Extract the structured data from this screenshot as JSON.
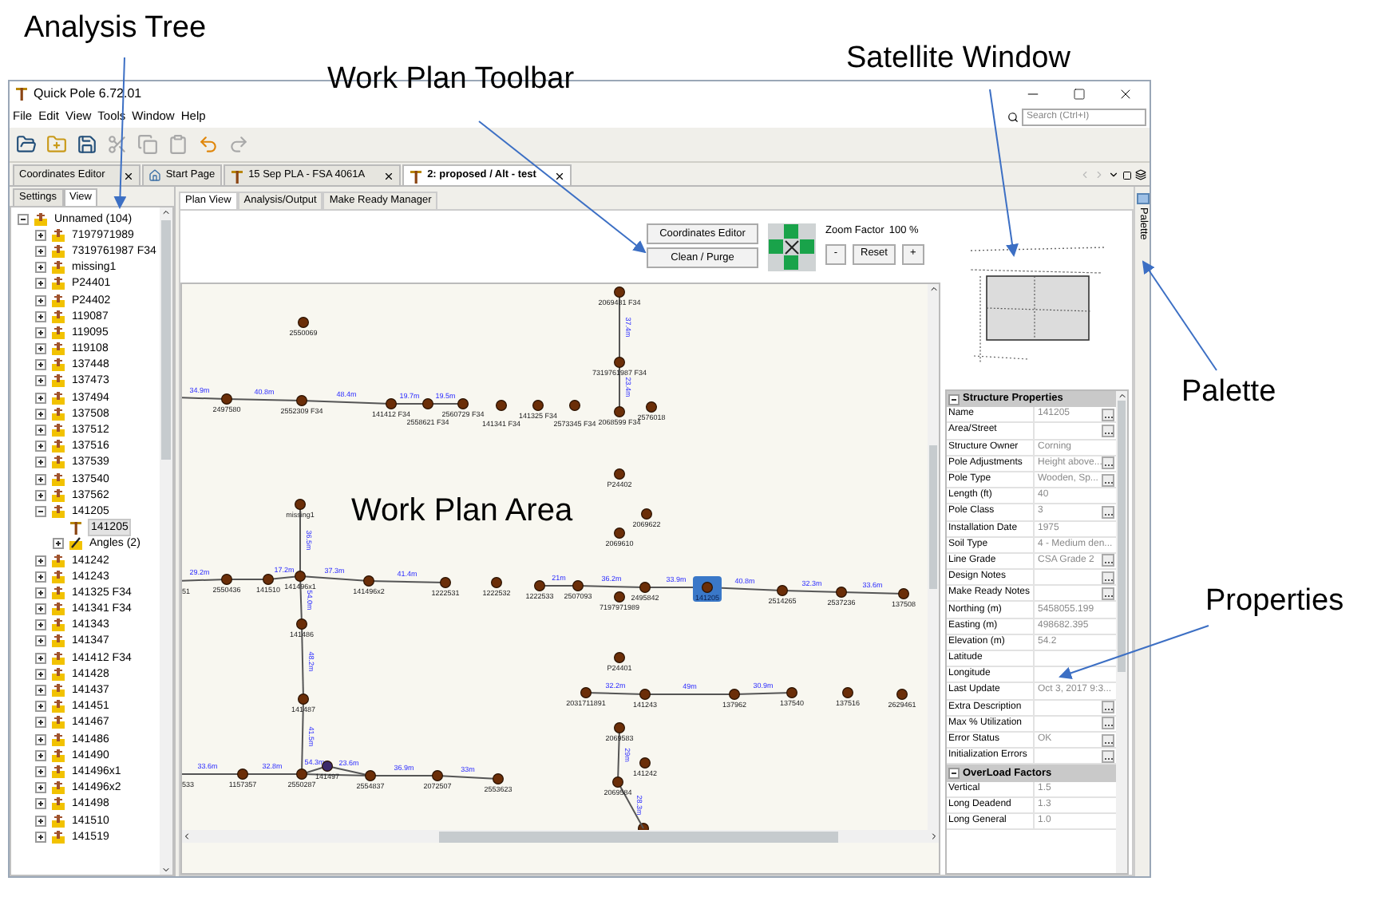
{
  "annotations": [
    {
      "text": "Analysis Tree"
    },
    {
      "text": "Work Plan Toolbar"
    },
    {
      "text": "Satellite Window"
    },
    {
      "text": "Palette"
    },
    {
      "text": "Properties"
    },
    {
      "text": "Work Plan Area"
    }
  ],
  "window": {
    "title": "Quick Pole 6.72.01",
    "search": {
      "placeholder": "Search (Ctrl+I)"
    }
  },
  "menu": [
    "File",
    "Edit",
    "View",
    "Tools",
    "Window",
    "Help"
  ],
  "toolbar": [
    {
      "kind": "open",
      "disabled": false
    },
    {
      "kind": "new",
      "disabled": false
    },
    {
      "kind": "save",
      "disabled": false
    },
    {
      "kind": "cut",
      "disabled": true
    },
    {
      "kind": "copy",
      "disabled": true
    },
    {
      "kind": "paste",
      "disabled": true
    },
    {
      "kind": "undo",
      "disabled": false
    },
    {
      "kind": "redo",
      "disabled": true
    }
  ],
  "doc_tabs": [
    {
      "label": "Coordinates Editor",
      "closable": true,
      "selected": false
    },
    {
      "label": "Start Page",
      "closable": false,
      "selected": false
    },
    {
      "label": "15 Sep PLA - FSA 4061A",
      "closable": true,
      "selected": false
    },
    {
      "label": "2: proposed / Alt - test",
      "closable": true,
      "selected": true
    }
  ],
  "left_tabs": [
    {
      "label": "Settings",
      "selected": false
    },
    {
      "label": "View",
      "selected": true
    }
  ],
  "tree": {
    "label": "Unnamed (104)",
    "expanded": true,
    "children": [
      {
        "label": "7197971989"
      },
      {
        "label": "7319761987 F34"
      },
      {
        "label": "missing1"
      },
      {
        "label": "P24401"
      },
      {
        "label": "P24402"
      },
      {
        "label": "119087"
      },
      {
        "label": "119095"
      },
      {
        "label": "119108"
      },
      {
        "label": "137448"
      },
      {
        "label": "137473"
      },
      {
        "label": "137494"
      },
      {
        "label": "137508"
      },
      {
        "label": "137512"
      },
      {
        "label": "137516"
      },
      {
        "label": "137539"
      },
      {
        "label": "137540"
      },
      {
        "label": "137562"
      },
      {
        "label": "141205",
        "expanded": true,
        "children": [
          {
            "label": "141205",
            "kind": "pole",
            "selected": true
          },
          {
            "label": "Angles (2)",
            "kind": "angles",
            "selected": false
          }
        ]
      },
      {
        "label": "141242"
      },
      {
        "label": "141243"
      },
      {
        "label": "141325 F34"
      },
      {
        "label": "141341 F34"
      },
      {
        "label": "141343"
      },
      {
        "label": "141347"
      },
      {
        "label": "141412 F34"
      },
      {
        "label": "141428"
      },
      {
        "label": "141437"
      },
      {
        "label": "141451"
      },
      {
        "label": "141467"
      },
      {
        "label": "141486"
      },
      {
        "label": "141490"
      },
      {
        "label": "141496x1"
      },
      {
        "label": "141496x2"
      },
      {
        "label": "141498"
      },
      {
        "label": "141510"
      },
      {
        "label": "141519"
      }
    ]
  },
  "view_tabs": [
    {
      "label": "Plan View",
      "selected": true
    },
    {
      "label": "Analysis/Output",
      "selected": false
    },
    {
      "label": "Make Ready Manager",
      "selected": false
    }
  ],
  "plan_toolbar": {
    "buttons": [
      "Coordinates Editor",
      "Clean / Purge"
    ],
    "zoom": {
      "label": "Zoom Factor",
      "value": "100 %",
      "buttons": [
        "-",
        "Reset",
        "+"
      ]
    }
  },
  "canvas": {
    "nodes": [
      {
        "label": "2550069",
        "selected": false
      },
      {
        "label": "2497580",
        "selected": false
      },
      {
        "label": "2552309 F34",
        "selected": false
      },
      {
        "label": "141412 F34",
        "selected": false
      },
      {
        "label": "2558621 F34",
        "selected": false
      },
      {
        "label": "2560729 F34",
        "selected": false
      },
      {
        "label": "141341 F34",
        "selected": false
      },
      {
        "label": "141325 F34",
        "selected": false
      },
      {
        "label": "2573345 F34",
        "selected": false
      },
      {
        "label": "2068599 F34",
        "selected": false
      },
      {
        "label": "2576018",
        "selected": false
      },
      {
        "label": "2069481 F34",
        "selected": false
      },
      {
        "label": "7319761987 F34",
        "selected": false
      },
      {
        "label": "P24402",
        "selected": false
      },
      {
        "label": "2069622",
        "selected": false
      },
      {
        "label": "2069610",
        "selected": false
      },
      {
        "label": "missing1",
        "selected": false
      },
      {
        "label": "2550436",
        "selected": false
      },
      {
        "label": "141510",
        "selected": false
      },
      {
        "label": "141496x1",
        "selected": false
      },
      {
        "label": "141496x2",
        "selected": false
      },
      {
        "label": "1222531",
        "selected": false
      },
      {
        "label": "1222532",
        "selected": false
      },
      {
        "label": "1222533",
        "selected": false
      },
      {
        "label": "2507093",
        "selected": false
      },
      {
        "label": "2495842",
        "selected": false
      },
      {
        "label": "7197971989",
        "selected": false
      },
      {
        "label": "141205",
        "selected": true
      },
      {
        "label": "2514265",
        "selected": false
      },
      {
        "label": "2537236",
        "selected": false
      },
      {
        "label": "137508",
        "selected": false
      },
      {
        "label": "141486",
        "selected": false
      },
      {
        "label": "141487",
        "selected": false
      },
      {
        "label": "1157357",
        "selected": false
      },
      {
        "label": "2550287",
        "selected": false
      },
      {
        "label": "141497",
        "selected": false
      },
      {
        "label": "2554837",
        "selected": false
      },
      {
        "label": "2072507",
        "selected": false
      },
      {
        "label": "2553623",
        "selected": false
      },
      {
        "label": "P24401",
        "selected": false
      },
      {
        "label": "2031711891",
        "selected": false
      },
      {
        "label": "141243",
        "selected": false
      },
      {
        "label": "137962",
        "selected": false
      },
      {
        "label": "137540",
        "selected": false
      },
      {
        "label": "137516",
        "selected": false
      },
      {
        "label": "2629461",
        "selected": false
      },
      {
        "label": "2069583",
        "selected": false
      },
      {
        "label": "141242",
        "selected": false
      },
      {
        "label": "2069584",
        "selected": false
      },
      {
        "label": "51"
      },
      {
        "label": "533"
      }
    ],
    "edges": [
      {
        "label": "34.9m"
      },
      {
        "label": "40.8m"
      },
      {
        "label": "48.4m"
      },
      {
        "label": "19.7m"
      },
      {
        "label": "19.5m"
      },
      {
        "label": "37.4m"
      },
      {
        "label": "23.4m"
      },
      {
        "label": "36.5m"
      },
      {
        "label": "29.2m"
      },
      {
        "label": "17.2m"
      },
      {
        "label": "37.3m"
      },
      {
        "label": "41.4m"
      },
      {
        "label": "21m"
      },
      {
        "label": "36.2m"
      },
      {
        "label": "33.9m"
      },
      {
        "label": "40.8m"
      },
      {
        "label": "32.3m"
      },
      {
        "label": "33.6m"
      },
      {
        "label": "54.0m"
      },
      {
        "label": "48.2m"
      },
      {
        "label": "41.5m"
      },
      {
        "label": "33.6m"
      },
      {
        "label": "32.8m"
      },
      {
        "label": "54.3m"
      },
      {
        "label": "23.6m"
      },
      {
        "label": "36.9m"
      },
      {
        "label": "33m"
      },
      {
        "label": "32.2m"
      },
      {
        "label": "49m"
      },
      {
        "label": "30.9m"
      },
      {
        "label": "29m"
      },
      {
        "label": "28.3m"
      }
    ]
  },
  "properties": {
    "groups": [
      {
        "title": "Structure Properties",
        "expanded": true,
        "rows": [
          {
            "name": "Name",
            "value": "141205",
            "kind": "button"
          },
          {
            "name": "Area/Street",
            "kind": "button"
          },
          {
            "name": "Structure Owner",
            "value": "Corning",
            "kind": "text"
          },
          {
            "name": "Pole Adjustments",
            "value": "Height above...",
            "kind": "button"
          },
          {
            "name": "Pole Type",
            "value": "Wooden, Sp...",
            "kind": "button"
          },
          {
            "name": "Length (ft)",
            "value": "40",
            "kind": "text"
          },
          {
            "name": "Pole Class",
            "value": "3",
            "kind": "button"
          },
          {
            "name": "Installation Date",
            "value": "1975",
            "kind": "text"
          },
          {
            "name": "Soil Type",
            "value": "4 - Medium den...",
            "kind": "text"
          },
          {
            "name": "Line Grade",
            "value": "CSA Grade 2",
            "kind": "button"
          },
          {
            "name": "Design Notes",
            "kind": "button"
          },
          {
            "name": "Make Ready Notes",
            "kind": "button"
          },
          {
            "name": "Northing (m)",
            "value": "5458055.199",
            "kind": "text"
          },
          {
            "name": "Easting (m)",
            "value": "498682.395",
            "kind": "text"
          },
          {
            "name": "Elevation (m)",
            "value": "54.2",
            "kind": "text"
          },
          {
            "name": "Latitude",
            "kind": "text"
          },
          {
            "name": "Longitude",
            "kind": "text"
          },
          {
            "name": "Last Update",
            "value": "Oct 3, 2017 9:3...",
            "kind": "text"
          },
          {
            "name": "Extra Description",
            "kind": "button"
          },
          {
            "name": "Max % Utilization",
            "kind": "button"
          },
          {
            "name": "Error Status",
            "value": "OK",
            "kind": "button"
          },
          {
            "name": "Initialization Errors",
            "kind": "button"
          }
        ]
      },
      {
        "title": "OverLoad Factors",
        "expanded": true,
        "rows": [
          {
            "name": "Vertical",
            "value": "1.5",
            "kind": "text"
          },
          {
            "name": "Long Deadend",
            "value": "1.3",
            "kind": "text"
          },
          {
            "name": "Long General",
            "value": "1.0",
            "kind": "text"
          }
        ]
      }
    ]
  },
  "palette": {
    "label": "Palette"
  }
}
